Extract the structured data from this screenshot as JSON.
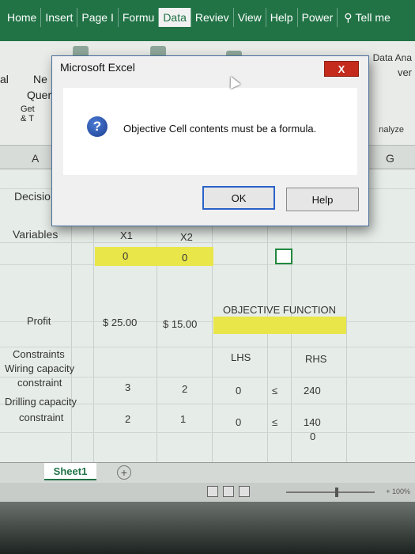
{
  "ribbon": {
    "tabs": [
      "Home",
      "Insert",
      "Page I",
      "Formu",
      "Data",
      "Reviev",
      "View",
      "Help",
      "Power"
    ],
    "active_tab": "Data",
    "tell_me": "Tell me"
  },
  "toolbar": {
    "left_partial_1": "al",
    "left_partial_2": "Ne",
    "left_partial_3": "Quer",
    "left_partial_4": "Get & T",
    "right_partial_1": "Data Ana",
    "right_partial_2": "ver",
    "right_partial_3": "nalyze"
  },
  "grid": {
    "col_headers": [
      "A",
      "G"
    ],
    "decision_label": "Decisio",
    "variables_label": "Variables",
    "x1_label": "X1",
    "x2_label": "X2",
    "x1_value": "0",
    "x2_value": "0",
    "objective_label": "OBJECTIVE FUNCTION",
    "profit_label": "Profit",
    "profit_x1": "$ 25.00",
    "profit_x2": "$ 15.00",
    "constraints_label": "Constraints",
    "lhs_label": "LHS",
    "rhs_label": "RHS",
    "wiring_1": "Wiring capacity",
    "wiring_2": "constraint",
    "wiring_x1": "3",
    "wiring_x2": "2",
    "wiring_lhs": "0",
    "wiring_sign": "≤",
    "wiring_rhs": "240",
    "drilling_1": "Drilling capacity",
    "drilling_2": "constraint",
    "drilling_x1": "2",
    "drilling_x2": "1",
    "drilling_lhs": "0",
    "drilling_sign": "≤",
    "drilling_rhs": "140",
    "extra_zero": "0"
  },
  "sheet": {
    "tab_label": "Sheet1",
    "add_label": "+",
    "zoom": "+ 100%"
  },
  "dialog": {
    "title": "Microsoft Excel",
    "close": "X",
    "message": "Objective Cell contents must be a formula.",
    "icon": "?",
    "ok": "OK",
    "help": "Help"
  },
  "colors": {
    "ribbon": "#217346",
    "yellow_cells": "#e9e64a",
    "close_button": "#c42b1c"
  }
}
